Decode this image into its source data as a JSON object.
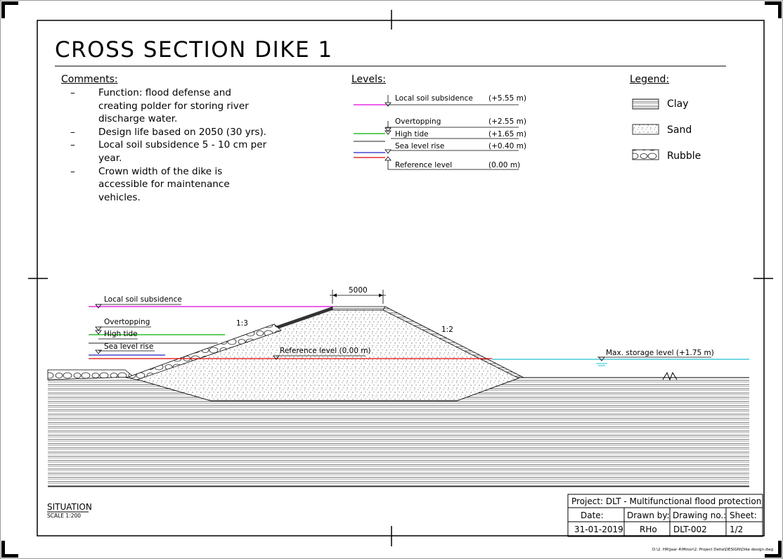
{
  "drawing": {
    "title": "CROSS SECTION DIKE 1",
    "file_path": "D:\\2. HR\\Jaar 4\\Minor\\2. Project Delta\\DESIGN\\Dike design.dwg"
  },
  "comments": {
    "heading": "Comments:",
    "items": [
      "Function: flood defense and creating polder for storing river discharge water.",
      "Design life based on 2050 (30 yrs).",
      "Local soil subsidence 5 - 10 cm per year.",
      "Crown width of the dike is accessible for maintenance vehicles."
    ]
  },
  "levels": {
    "heading": "Levels:",
    "items": [
      {
        "label": "Local soil subsidence",
        "value": "(+5.55 m)",
        "color": "#e000e0"
      },
      {
        "label": "Overtopping",
        "value": "(+2.55 m)",
        "color": "#222222"
      },
      {
        "label": "High tide",
        "value": "(+1.65 m)",
        "color": "#00b000"
      },
      {
        "label": "Sea level rise",
        "value": "(+0.40 m)",
        "color": "#2020c0"
      },
      {
        "label": "Reference level",
        "value": "(0.00 m)",
        "color": "#e00000"
      }
    ]
  },
  "legend": {
    "heading": "Legend:",
    "items": [
      {
        "label": "Clay",
        "pattern": "clay-hatch"
      },
      {
        "label": "Sand",
        "pattern": "sand-dots"
      },
      {
        "label": "Rubble",
        "pattern": "rubble-stones"
      }
    ]
  },
  "section": {
    "crown_width": "5000",
    "slope_left": "1:3",
    "slope_right": "1:2",
    "left_labels": [
      "Local soil subsidence",
      "Overtopping",
      "High tide",
      "Sea level rise"
    ],
    "reference_label": "Reference level (0.00 m)",
    "storage_label": "Max. storage level (+1.75 m)",
    "storage_color": "#20c0d0"
  },
  "situation": {
    "label": "SITUATION",
    "scale": "SCALE 1:200"
  },
  "title_block": {
    "project": "Project: DLT - Multifunctional flood protection",
    "date_label": "Date:",
    "drawn_by_label": "Drawn by:",
    "drawing_no_label": "Drawing no.:",
    "sheet_label": "Sheet:",
    "date": "31-01-2019",
    "drawn_by": "RHo",
    "drawing_no": "DLT-002",
    "sheet": "1/2"
  }
}
